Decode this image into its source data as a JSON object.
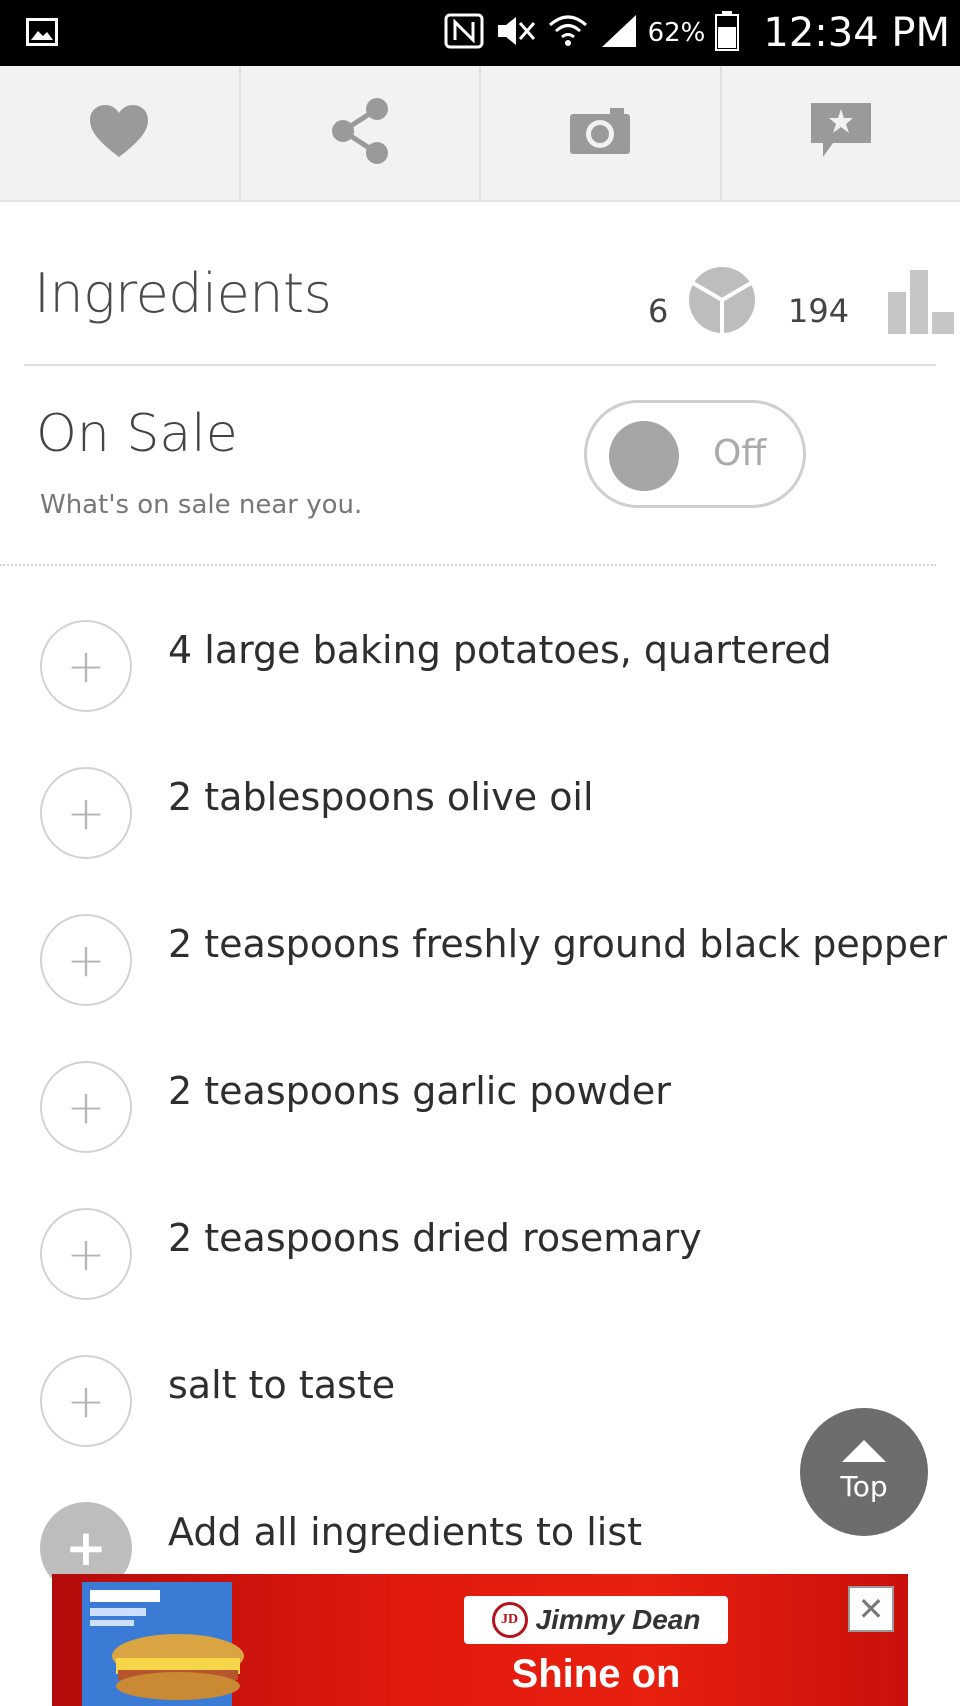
{
  "status_bar": {
    "battery_percent": "62%",
    "time": "12:34 PM",
    "icons": [
      "gallery-icon",
      "nfc-icon",
      "mute-icon",
      "wifi-icon",
      "signal-icon",
      "battery-icon"
    ]
  },
  "toolbar": {
    "buttons": [
      {
        "icon": "heart-icon"
      },
      {
        "icon": "share-icon"
      },
      {
        "icon": "camera-icon"
      },
      {
        "icon": "review-icon"
      }
    ]
  },
  "ingredients_header": {
    "title": "Ingredients",
    "servings": "6",
    "calories": "194"
  },
  "on_sale": {
    "title": "On Sale",
    "subtitle": "What's on sale near you.",
    "toggle_label": "Off"
  },
  "ingredients": [
    {
      "text": "4 large baking potatoes, quartered"
    },
    {
      "text": "2 tablespoons olive oil"
    },
    {
      "text": "2 teaspoons freshly ground black pepper"
    },
    {
      "text": "2 teaspoons garlic powder"
    },
    {
      "text": "2 teaspoons dried rosemary"
    },
    {
      "text": "salt to taste"
    }
  ],
  "plus_symbol": "+",
  "add_all": {
    "label": "Add all ingredients to list"
  },
  "top_button": {
    "label": "Top"
  },
  "ad": {
    "brand": "Jimmy Dean",
    "brand_initials": "JD",
    "slogan": "Shine on",
    "close_symbol": "✕"
  },
  "colors": {
    "toolbar_bg": "#f2f2f2",
    "icon_gray": "#9a9a9a",
    "ad_red": "#e01a0d"
  }
}
